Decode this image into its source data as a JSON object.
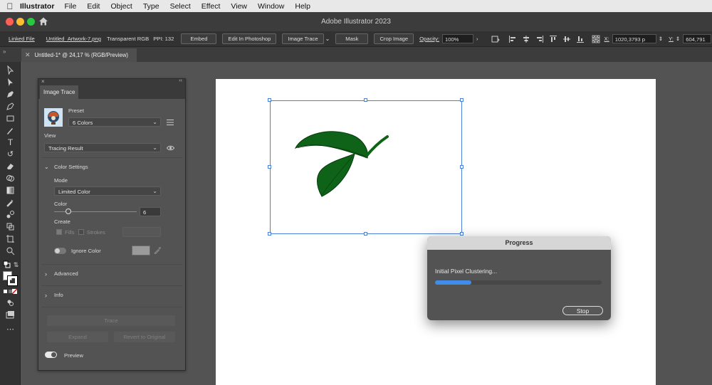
{
  "menubar": {
    "app_name": "Illustrator",
    "items": [
      "File",
      "Edit",
      "Object",
      "Type",
      "Select",
      "Effect",
      "View",
      "Window",
      "Help"
    ]
  },
  "window": {
    "title": "Adobe Illustrator 2023"
  },
  "control_bar": {
    "linked_file": "Linked File",
    "filename": "Untitled_Artwork-7.png",
    "color_mode": "Transparent RGB",
    "ppi": "PPI: 132",
    "embed": "Embed",
    "edit_in_photoshop": "Edit In Photoshop",
    "image_trace": "Image Trace",
    "mask": "Mask",
    "crop_image": "Crop Image",
    "opacity_label": "Opacity:",
    "opacity_value": "100%",
    "x_label": "X:",
    "x_value": "1020,3793 p",
    "y_label": "Y:",
    "y_value": "604,791"
  },
  "document_tab": {
    "label": "Untitled-1* @ 24,17 % (RGB/Preview)"
  },
  "image_trace_panel": {
    "tab_label": "Image Trace",
    "preset_label": "Preset",
    "preset_value": "6 Colors",
    "view_label": "View",
    "view_value": "Tracing Result",
    "color_settings_label": "Color Settings",
    "mode_label": "Mode",
    "mode_value": "Limited Color",
    "color_label": "Color",
    "color_value": "6",
    "color_slider_fraction": 0.17,
    "create_label": "Create",
    "fills_label": "Fills",
    "strokes_label": "Strokes",
    "ignore_color_label": "Ignore Color",
    "advanced_label": "Advanced",
    "info_label": "Info",
    "trace_button": "Trace",
    "expand_button": "Expand",
    "revert_button": "Revert to Original",
    "preview_label": "Preview"
  },
  "progress_dialog": {
    "title": "Progress",
    "message": "Initial Pixel Clustering...",
    "progress_fraction": 0.22,
    "stop_button": "Stop"
  },
  "colors": {
    "accent_blue": "#3f8de8",
    "selection_blue": "#4c7fd6",
    "leaf_green": "#0f6318",
    "traffic_red": "#ff5f57",
    "traffic_yellow": "#febc2e",
    "traffic_green": "#28c840"
  }
}
